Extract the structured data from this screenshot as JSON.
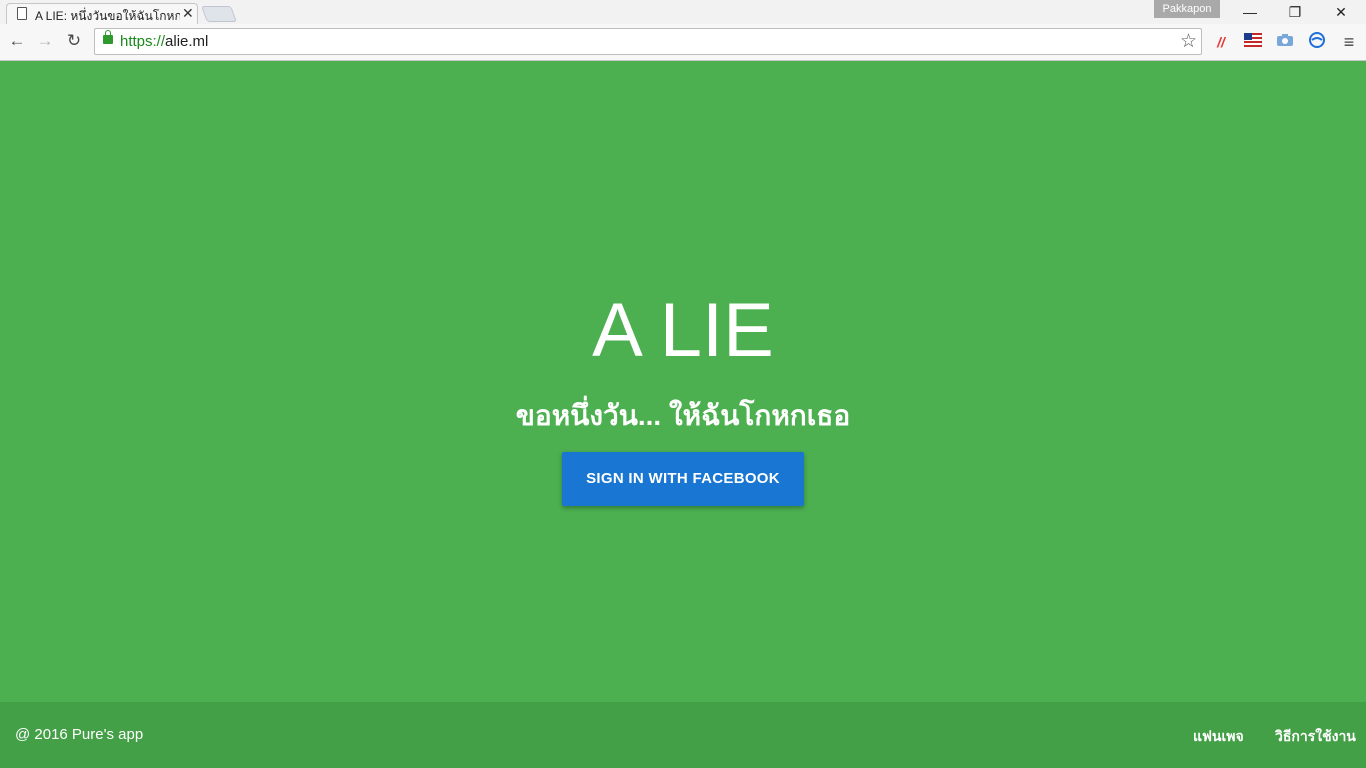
{
  "browser": {
    "tab_title": "A LIE: หนึ่งวันขอให้ฉันโกหกเธอ",
    "tab_close": "✕",
    "profile_name": "Pakkapon",
    "window_controls": {
      "minimize": "—",
      "restore": "❐",
      "close": "✕"
    },
    "url_scheme": "https://",
    "url_host": "alie.ml",
    "extensions": [
      "m-extension-icon",
      "flag-extension-icon",
      "camera-extension-icon",
      "sync-extension-icon",
      "menu-icon"
    ],
    "accent_secure": "#2e9a2e"
  },
  "hero": {
    "title": "A LIE",
    "subtitle": "ขอหนึ่งวัน... ให้ฉันโกหกเธอ",
    "signin_label": "SIGN IN WITH FACEBOOK",
    "background_color": "#4caf50",
    "button_color": "#1976d2"
  },
  "footer": {
    "copyright": "@ 2016 Pure's app",
    "links": [
      {
        "label": "แฟนเพจ"
      },
      {
        "label": "วิธีการใช้งาน"
      }
    ],
    "background_color": "#43a047"
  }
}
